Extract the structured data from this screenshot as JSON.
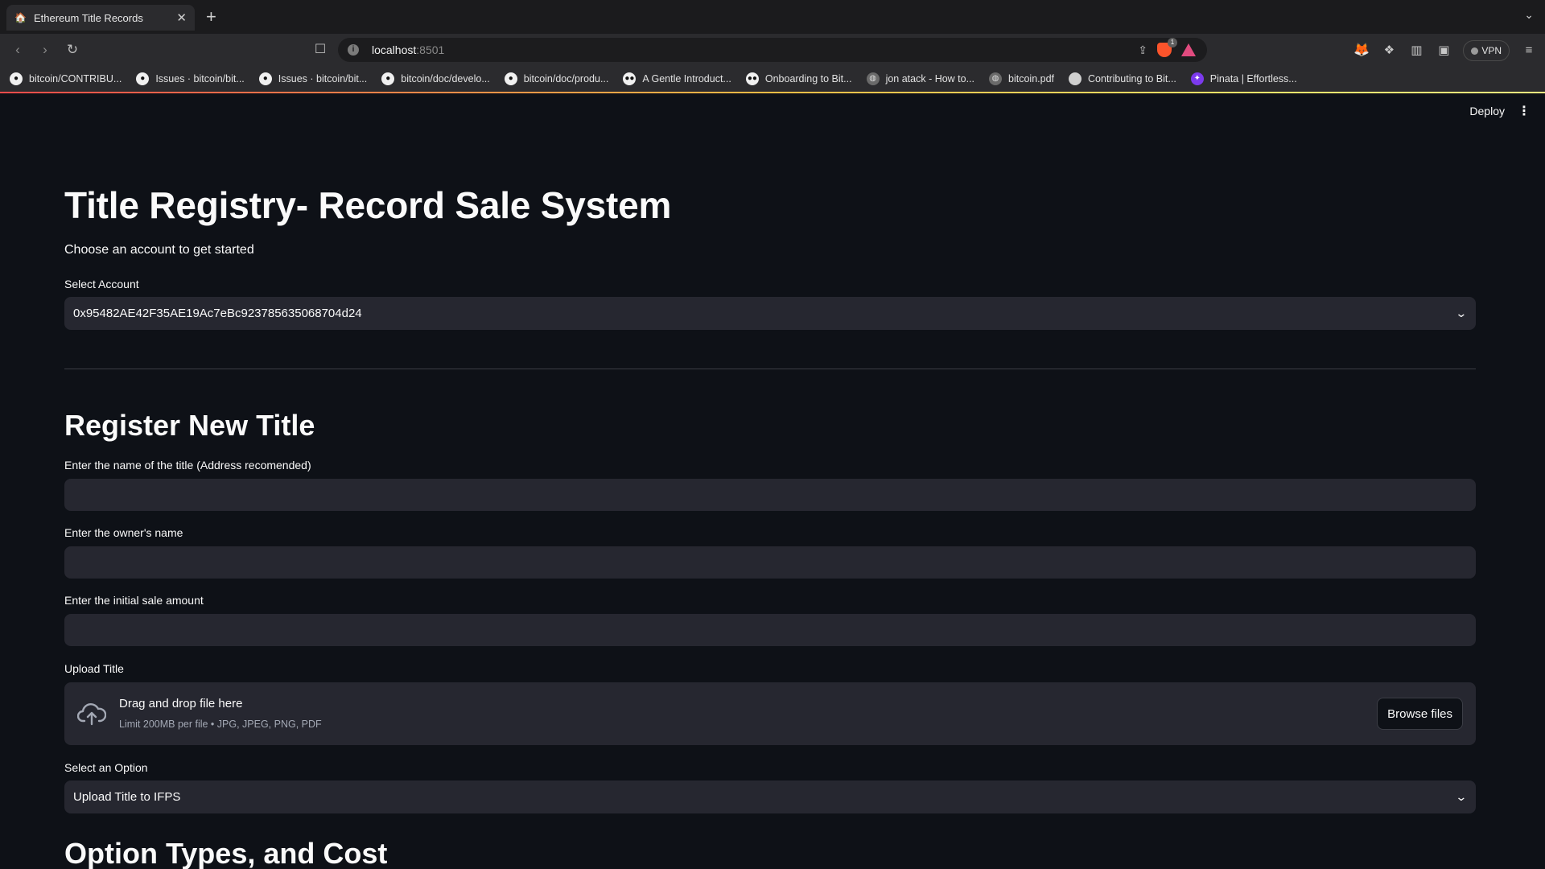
{
  "browser": {
    "tab_title": "Ethereum Title Records",
    "tab_favicon": "🏠",
    "url_host": "localhost",
    "url_port": ":8501",
    "brave_badge": "1",
    "vpn_label": "VPN"
  },
  "bookmarks": [
    {
      "label": "bitcoin/CONTRIBU...",
      "icon": "github-icon"
    },
    {
      "label": "Issues · bitcoin/bit...",
      "icon": "github-icon"
    },
    {
      "label": "Issues · bitcoin/bit...",
      "icon": "github-icon"
    },
    {
      "label": "bitcoin/doc/develo...",
      "icon": "github-icon"
    },
    {
      "label": "bitcoin/doc/produ...",
      "icon": "github-icon"
    },
    {
      "label": "A Gentle Introduct...",
      "icon": "medium-icon"
    },
    {
      "label": "Onboarding to Bit...",
      "icon": "medium-icon"
    },
    {
      "label": "jon atack - How to...",
      "icon": "globe-icon"
    },
    {
      "label": "bitcoin.pdf",
      "icon": "globe-icon"
    },
    {
      "label": "Contributing to Bit...",
      "icon": "laptop-icon"
    },
    {
      "label": "Pinata | Effortless...",
      "icon": "pinata-icon"
    }
  ],
  "app": {
    "deploy_label": "Deploy",
    "title": "Title Registry- Record Sale System",
    "subtitle": "Choose an account to get started",
    "account_label": "Select Account",
    "account_value": "0x95482AE42F35AE19Ac7eBc923785635068704d24",
    "register_heading": "Register New Title",
    "title_name_label": "Enter the name of the title (Address recomended)",
    "owner_label": "Enter the owner's name",
    "amount_label": "Enter the initial sale amount",
    "upload_label": "Upload Title",
    "drop_title": "Drag and drop file here",
    "drop_hint": "Limit 200MB per file • JPG, JPEG, PNG, PDF",
    "browse_label": "Browse files",
    "option_label": "Select an Option",
    "option_value": "Upload Title to IFPS",
    "option_types_heading": "Option Types, and Cost"
  }
}
